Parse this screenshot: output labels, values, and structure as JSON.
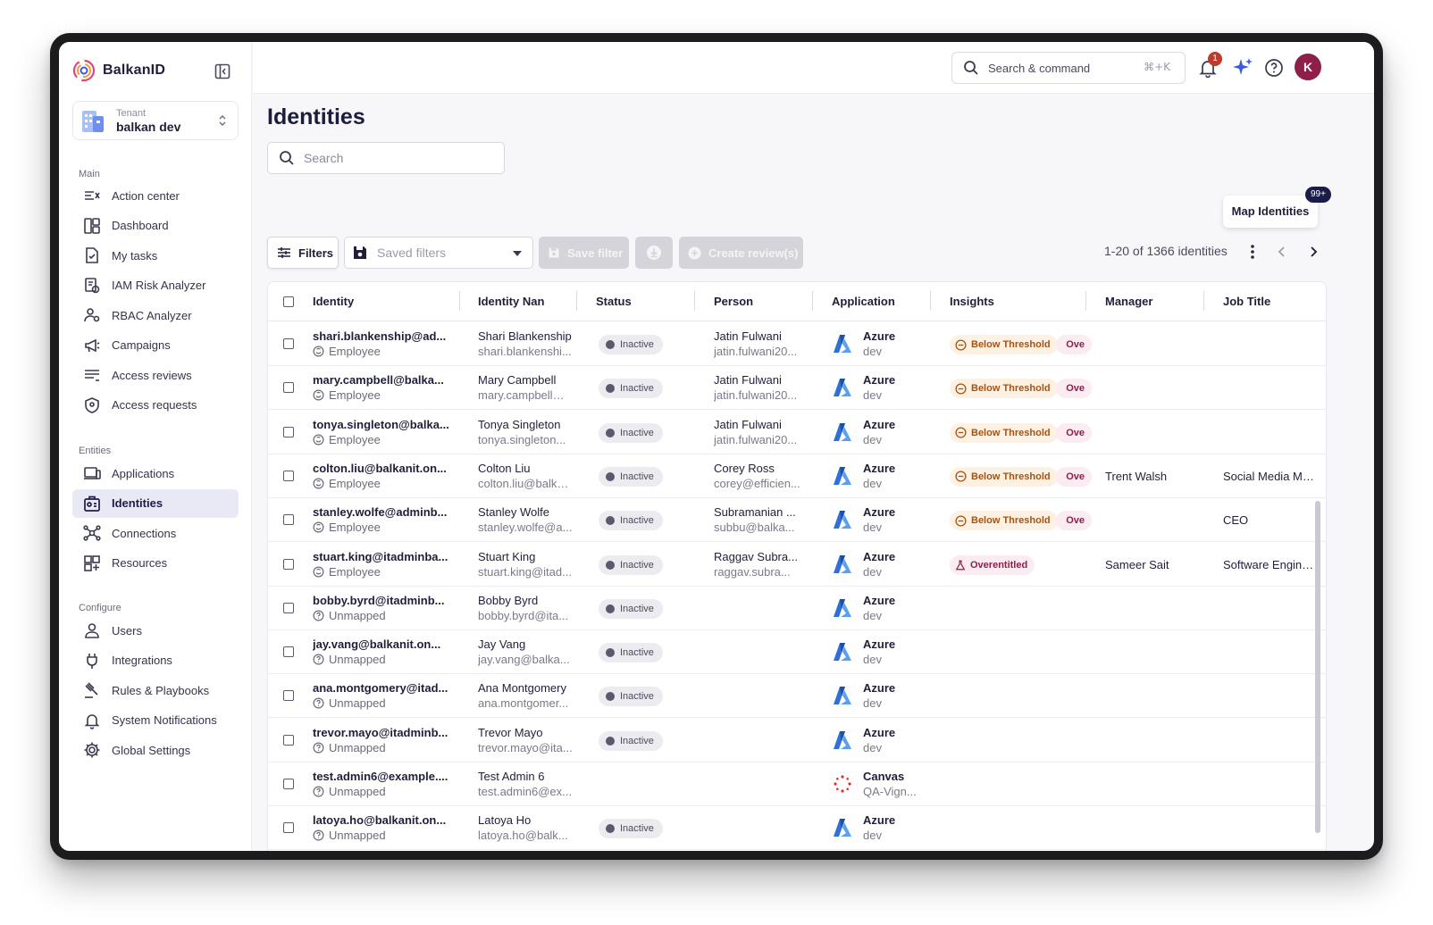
{
  "brand": {
    "name": "BalkanID"
  },
  "tenant": {
    "label": "Tenant",
    "value": "balkan dev"
  },
  "sidebar": {
    "main_label": "Main",
    "main_items": [
      {
        "label": "Action center",
        "icon": "action-center-icon"
      },
      {
        "label": "Dashboard",
        "icon": "dashboard-icon"
      },
      {
        "label": "My tasks",
        "icon": "tasks-icon"
      },
      {
        "label": "IAM Risk Analyzer",
        "icon": "risk-analyzer-icon"
      },
      {
        "label": "RBAC Analyzer",
        "icon": "rbac-icon"
      },
      {
        "label": "Campaigns",
        "icon": "megaphone-icon"
      },
      {
        "label": "Access reviews",
        "icon": "reviews-icon"
      },
      {
        "label": "Access requests",
        "icon": "shield-icon"
      }
    ],
    "entities_label": "Entities",
    "entities_items": [
      {
        "label": "Applications",
        "icon": "applications-icon"
      },
      {
        "label": "Identities",
        "icon": "identity-card-icon",
        "active": true
      },
      {
        "label": "Connections",
        "icon": "network-icon"
      },
      {
        "label": "Resources",
        "icon": "resources-icon"
      }
    ],
    "configure_label": "Configure",
    "configure_items": [
      {
        "label": "Users",
        "icon": "user-icon"
      },
      {
        "label": "Integrations",
        "icon": "plug-icon"
      },
      {
        "label": "Rules & Playbooks",
        "icon": "gavel-icon"
      },
      {
        "label": "System Notifications",
        "icon": "bell-icon"
      },
      {
        "label": "Global Settings",
        "icon": "gear-icon"
      }
    ]
  },
  "topbar": {
    "search_label": "Search & command",
    "search_shortcut": "⌘+K",
    "notification_count": "1",
    "avatar_initial": "K"
  },
  "page": {
    "title": "Identities",
    "search_placeholder": "Search",
    "map_identities": "Map Identities",
    "map_badge": "99+",
    "filters_label": "Filters",
    "saved_filters_placeholder": "Saved filters",
    "save_filter_label": "Save filter",
    "create_review_label": "Create review(s)",
    "pagination": "1-20 of 1366 identities"
  },
  "table": {
    "columns": [
      "Identity",
      "Identity Nan",
      "Status",
      "Person",
      "Application",
      "Insights",
      "Manager",
      "Job Title"
    ],
    "rows": [
      {
        "identity": "shari.blankenship@ad...",
        "type": "Employee",
        "name": "Shari Blankenship",
        "name_sub": "shari.blankenshi...",
        "status": "Inactive",
        "person": "Jatin Fulwani",
        "person_sub": "jatin.fulwani20...",
        "app": "Azure",
        "app_sub": "dev",
        "app_kind": "azure",
        "insights": [
          "Below Threshold",
          "Ove"
        ],
        "manager": "",
        "job": ""
      },
      {
        "identity": "mary.campbell@balka...",
        "type": "Employee",
        "name": "Mary Campbell",
        "name_sub": "mary.campbell@...",
        "status": "Inactive",
        "person": "Jatin Fulwani",
        "person_sub": "jatin.fulwani20...",
        "app": "Azure",
        "app_sub": "dev",
        "app_kind": "azure",
        "insights": [
          "Below Threshold",
          "Ove"
        ],
        "manager": "",
        "job": ""
      },
      {
        "identity": "tonya.singleton@balka...",
        "type": "Employee",
        "name": "Tonya Singleton",
        "name_sub": "tonya.singleton...",
        "status": "Inactive",
        "person": "Jatin Fulwani",
        "person_sub": "jatin.fulwani20...",
        "app": "Azure",
        "app_sub": "dev",
        "app_kind": "azure",
        "insights": [
          "Below Threshold",
          "Ove"
        ],
        "manager": "",
        "job": ""
      },
      {
        "identity": "colton.liu@balkanit.on...",
        "type": "Employee",
        "name": "Colton Liu",
        "name_sub": "colton.liu@balka...",
        "status": "Inactive",
        "person": "Corey Ross",
        "person_sub": "corey@efficien...",
        "app": "Azure",
        "app_sub": "dev",
        "app_kind": "azure",
        "insights": [
          "Below Threshold",
          "Ove"
        ],
        "manager": "Trent Walsh",
        "job": "Social Media Ma..."
      },
      {
        "identity": "stanley.wolfe@adminb...",
        "type": "Employee",
        "name": "Stanley Wolfe",
        "name_sub": "stanley.wolfe@a...",
        "status": "Inactive",
        "person": "Subramanian ...",
        "person_sub": "subbu@balka...",
        "app": "Azure",
        "app_sub": "dev",
        "app_kind": "azure",
        "insights": [
          "Below Threshold",
          "Ove"
        ],
        "manager": "",
        "job": "CEO"
      },
      {
        "identity": "stuart.king@itadminba...",
        "type": "Employee",
        "name": "Stuart King",
        "name_sub": "stuart.king@itad...",
        "status": "Inactive",
        "person": "Raggav Subra...",
        "person_sub": "raggav.subra...",
        "app": "Azure",
        "app_sub": "dev",
        "app_kind": "azure",
        "insights": [
          "Overentitled"
        ],
        "manager": "Sameer Sait",
        "job": "Software Engine..."
      },
      {
        "identity": "bobby.byrd@itadminb...",
        "type": "Unmapped",
        "name": "Bobby Byrd",
        "name_sub": "bobby.byrd@ita...",
        "status": "Inactive",
        "person": "",
        "person_sub": "",
        "app": "Azure",
        "app_sub": "dev",
        "app_kind": "azure",
        "insights": [],
        "manager": "",
        "job": ""
      },
      {
        "identity": "jay.vang@balkanit.on...",
        "type": "Unmapped",
        "name": "Jay Vang",
        "name_sub": "jay.vang@balka...",
        "status": "Inactive",
        "person": "",
        "person_sub": "",
        "app": "Azure",
        "app_sub": "dev",
        "app_kind": "azure",
        "insights": [],
        "manager": "",
        "job": ""
      },
      {
        "identity": "ana.montgomery@itad...",
        "type": "Unmapped",
        "name": "Ana Montgomery",
        "name_sub": "ana.montgomer...",
        "status": "Inactive",
        "person": "",
        "person_sub": "",
        "app": "Azure",
        "app_sub": "dev",
        "app_kind": "azure",
        "insights": [],
        "manager": "",
        "job": ""
      },
      {
        "identity": "trevor.mayo@itadminb...",
        "type": "Unmapped",
        "name": "Trevor Mayo",
        "name_sub": "trevor.mayo@ita...",
        "status": "Inactive",
        "person": "",
        "person_sub": "",
        "app": "Azure",
        "app_sub": "dev",
        "app_kind": "azure",
        "insights": [],
        "manager": "",
        "job": ""
      },
      {
        "identity": "test.admin6@example....",
        "type": "Unmapped",
        "name": "Test Admin 6",
        "name_sub": "test.admin6@ex...",
        "status": "",
        "person": "",
        "person_sub": "",
        "app": "Canvas",
        "app_sub": "QA-Vign...",
        "app_kind": "canvas",
        "insights": [],
        "manager": "",
        "job": ""
      },
      {
        "identity": "latoya.ho@balkanit.on...",
        "type": "Unmapped",
        "name": "Latoya Ho",
        "name_sub": "latoya.ho@balk...",
        "status": "Inactive",
        "person": "",
        "person_sub": "",
        "app": "Azure",
        "app_sub": "dev",
        "app_kind": "azure",
        "insights": [],
        "manager": "",
        "job": ""
      }
    ]
  },
  "colors": {
    "accent": "#1c1c4a",
    "active_bg": "#e9e9f6",
    "azure": "#2f6fd6",
    "below_threshold": "#a35412",
    "overentitled": "#8e1f4b",
    "avatar": "#8e1f4b"
  }
}
